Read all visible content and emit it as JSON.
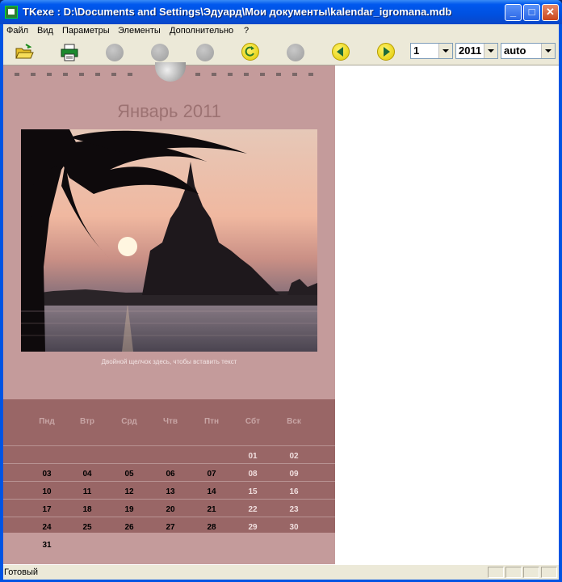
{
  "window": {
    "title": "TKexe : D:\\Documents and Settings\\Эдуард\\Мои документы\\kalendar_igromana.mdb",
    "minimize": "_",
    "maximize": "□",
    "close": "✕"
  },
  "menu": [
    "Файл",
    "Вид",
    "Параметры",
    "Элементы",
    "Дополнительно",
    "?"
  ],
  "toolbar": {
    "icons": [
      "open-folder-icon",
      "printer-icon",
      "disabled-icon",
      "disabled-icon",
      "disabled-icon",
      "refresh-icon",
      "disabled-icon",
      "arrow-left-icon",
      "arrow-right-icon"
    ],
    "month_value": "1",
    "year_value": "2011",
    "zoom_value": "auto"
  },
  "calendar": {
    "title": "Январь 2011",
    "caption": "Двойной щелчок здесь, чтобы вставить текст",
    "day_names": [
      "Пнд",
      "Втр",
      "Срд",
      "Чтв",
      "Птн",
      "Сбт",
      "Вск"
    ],
    "weeks": [
      [
        "",
        "",
        "",
        "",
        "",
        "01",
        "02"
      ],
      [
        "03",
        "04",
        "05",
        "06",
        "07",
        "08",
        "09"
      ],
      [
        "10",
        "11",
        "12",
        "13",
        "14",
        "15",
        "16"
      ],
      [
        "17",
        "18",
        "19",
        "20",
        "21",
        "22",
        "23"
      ],
      [
        "24",
        "25",
        "26",
        "27",
        "28",
        "29",
        "30"
      ],
      [
        "31",
        "",
        "",
        "",
        "",
        "",
        ""
      ]
    ],
    "colors": {
      "page": "#c49b9b",
      "grid": "#996666",
      "title": "#9c7272",
      "weekend": "#f0dede"
    }
  },
  "status": {
    "text": "Готовый"
  }
}
